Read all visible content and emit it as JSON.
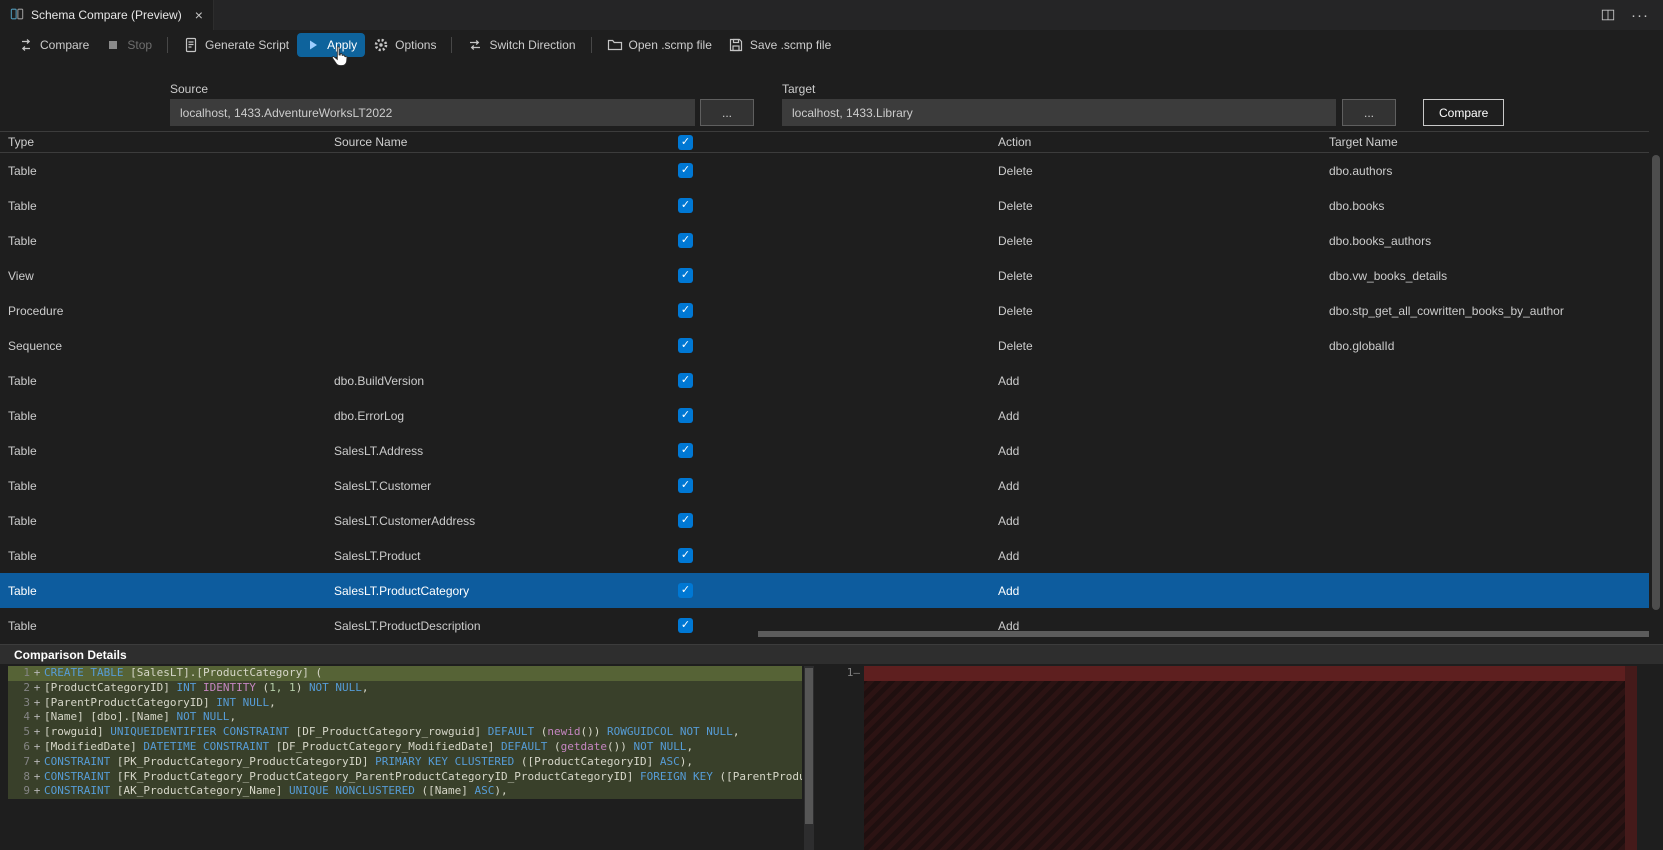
{
  "tab_bar": {
    "tab_title": "Schema Compare (Preview)",
    "close_glyph": "×",
    "more_actions_glyph": "···"
  },
  "toolbar": {
    "items": [
      {
        "label": "Compare",
        "icon": "compare-icon",
        "state": "normal",
        "sep_after": false
      },
      {
        "label": "Stop",
        "icon": "stop-icon",
        "state": "disabled",
        "sep_after": true
      },
      {
        "label": "Generate Script",
        "icon": "script-icon",
        "state": "normal",
        "sep_after": false
      },
      {
        "label": "Apply",
        "icon": "play-icon",
        "state": "active",
        "sep_after": false
      },
      {
        "label": "Options",
        "icon": "gear-icon",
        "state": "normal",
        "sep_after": true
      },
      {
        "label": "Switch Direction",
        "icon": "switch-icon",
        "state": "normal",
        "sep_after": true
      },
      {
        "label": "Open .scmp file",
        "icon": "open-file-icon",
        "state": "normal",
        "sep_after": false
      },
      {
        "label": "Save .scmp file",
        "icon": "save-file-icon",
        "state": "normal",
        "sep_after": false
      }
    ]
  },
  "connections": {
    "source_label": "Source",
    "source_value": "localhost, 1433.AdventureWorksLT2022",
    "target_label": "Target",
    "target_value": "localhost, 1433.Library",
    "browse_label": "...",
    "compare_label": "Compare"
  },
  "grid": {
    "headers": {
      "type": "Type",
      "source": "Source Name",
      "action": "Action",
      "target": "Target Name"
    },
    "check_glyph": "✓",
    "header_checkbox_checked": true,
    "rows": [
      {
        "type": "Table",
        "source": "",
        "checked": true,
        "action": "Delete",
        "target": "dbo.authors",
        "selected": false
      },
      {
        "type": "Table",
        "source": "",
        "checked": true,
        "action": "Delete",
        "target": "dbo.books",
        "selected": false
      },
      {
        "type": "Table",
        "source": "",
        "checked": true,
        "action": "Delete",
        "target": "dbo.books_authors",
        "selected": false
      },
      {
        "type": "View",
        "source": "",
        "checked": true,
        "action": "Delete",
        "target": "dbo.vw_books_details",
        "selected": false
      },
      {
        "type": "Procedure",
        "source": "",
        "checked": true,
        "action": "Delete",
        "target": "dbo.stp_get_all_cowritten_books_by_author",
        "selected": false
      },
      {
        "type": "Sequence",
        "source": "",
        "checked": true,
        "action": "Delete",
        "target": "dbo.globalId",
        "selected": false
      },
      {
        "type": "Table",
        "source": "dbo.BuildVersion",
        "checked": true,
        "action": "Add",
        "target": "",
        "selected": false
      },
      {
        "type": "Table",
        "source": "dbo.ErrorLog",
        "checked": true,
        "action": "Add",
        "target": "",
        "selected": false
      },
      {
        "type": "Table",
        "source": "SalesLT.Address",
        "checked": true,
        "action": "Add",
        "target": "",
        "selected": false
      },
      {
        "type": "Table",
        "source": "SalesLT.Customer",
        "checked": true,
        "action": "Add",
        "target": "",
        "selected": false
      },
      {
        "type": "Table",
        "source": "SalesLT.CustomerAddress",
        "checked": true,
        "action": "Add",
        "target": "",
        "selected": false
      },
      {
        "type": "Table",
        "source": "SalesLT.Product",
        "checked": true,
        "action": "Add",
        "target": "",
        "selected": false
      },
      {
        "type": "Table",
        "source": "SalesLT.ProductCategory",
        "checked": true,
        "action": "Add",
        "target": "",
        "selected": true
      },
      {
        "type": "Table",
        "source": "SalesLT.ProductDescription",
        "checked": true,
        "action": "Add",
        "target": "",
        "selected": false
      }
    ]
  },
  "details": {
    "title": "Comparison Details",
    "left": {
      "lines": [
        {
          "num": "1",
          "sign": "+",
          "emphasis": true,
          "tokens": [
            {
              "t": "CREATE TABLE",
              "c": "kw"
            },
            {
              "t": " [SalesLT].[ProductCategory] (",
              "c": "id"
            }
          ]
        },
        {
          "num": "2",
          "sign": "+",
          "emphasis": false,
          "tokens": [
            {
              "t": "[ProductCategoryID] ",
              "c": "id"
            },
            {
              "t": "INT",
              "c": "kw"
            },
            {
              "t": " ",
              "c": "id"
            },
            {
              "t": "IDENTITY",
              "c": "fn"
            },
            {
              "t": " (",
              "c": "id"
            },
            {
              "t": "1, 1",
              "c": "num"
            },
            {
              "t": ") ",
              "c": "id"
            },
            {
              "t": "NOT NULL",
              "c": "kw"
            },
            {
              "t": ",",
              "c": "id"
            }
          ]
        },
        {
          "num": "3",
          "sign": "+",
          "emphasis": false,
          "tokens": [
            {
              "t": "[ParentProductCategoryID] ",
              "c": "id"
            },
            {
              "t": "INT NULL",
              "c": "kw"
            },
            {
              "t": ",",
              "c": "id"
            }
          ]
        },
        {
          "num": "4",
          "sign": "+",
          "emphasis": false,
          "tokens": [
            {
              "t": "[Name] [dbo].[Name] ",
              "c": "id"
            },
            {
              "t": "NOT NULL",
              "c": "kw"
            },
            {
              "t": ",",
              "c": "id"
            }
          ]
        },
        {
          "num": "5",
          "sign": "+",
          "emphasis": false,
          "tokens": [
            {
              "t": "[rowguid] ",
              "c": "id"
            },
            {
              "t": "UNIQUEIDENTIFIER CONSTRAINT",
              "c": "kw"
            },
            {
              "t": " [DF_ProductCategory_rowguid] ",
              "c": "id"
            },
            {
              "t": "DEFAULT",
              "c": "kw"
            },
            {
              "t": " (",
              "c": "id"
            },
            {
              "t": "newid",
              "c": "fn"
            },
            {
              "t": "()) ",
              "c": "id"
            },
            {
              "t": "ROWGUIDCOL NOT NULL",
              "c": "kw"
            },
            {
              "t": ",",
              "c": "id"
            }
          ]
        },
        {
          "num": "6",
          "sign": "+",
          "emphasis": false,
          "tokens": [
            {
              "t": "[ModifiedDate] ",
              "c": "id"
            },
            {
              "t": "DATETIME CONSTRAINT",
              "c": "kw"
            },
            {
              "t": " [DF_ProductCategory_ModifiedDate] ",
              "c": "id"
            },
            {
              "t": "DEFAULT",
              "c": "kw"
            },
            {
              "t": " (",
              "c": "id"
            },
            {
              "t": "getdate",
              "c": "fn"
            },
            {
              "t": "()) ",
              "c": "id"
            },
            {
              "t": "NOT NULL",
              "c": "kw"
            },
            {
              "t": ",",
              "c": "id"
            }
          ]
        },
        {
          "num": "7",
          "sign": "+",
          "emphasis": false,
          "tokens": [
            {
              "t": "CONSTRAINT",
              "c": "kw"
            },
            {
              "t": " [PK_ProductCategory_ProductCategoryID] ",
              "c": "id"
            },
            {
              "t": "PRIMARY KEY CLUSTERED",
              "c": "kw"
            },
            {
              "t": " ([ProductCategoryID] ",
              "c": "id"
            },
            {
              "t": "ASC",
              "c": "kw"
            },
            {
              "t": "),",
              "c": "id"
            }
          ]
        },
        {
          "num": "8",
          "sign": "+",
          "emphasis": false,
          "tokens": [
            {
              "t": "CONSTRAINT",
              "c": "kw"
            },
            {
              "t": " [FK_ProductCategory_ProductCategory_ParentProductCategoryID_ProductCategoryID] ",
              "c": "id"
            },
            {
              "t": "FOREIGN KEY",
              "c": "kw"
            },
            {
              "t": " ([ParentProductCatego",
              "c": "id"
            }
          ]
        },
        {
          "num": "9",
          "sign": "+",
          "emphasis": false,
          "tokens": [
            {
              "t": "CONSTRAINT",
              "c": "kw"
            },
            {
              "t": " [AK_ProductCategory_Name] ",
              "c": "id"
            },
            {
              "t": "UNIQUE NONCLUSTERED",
              "c": "kw"
            },
            {
              "t": " ([Name] ",
              "c": "id"
            },
            {
              "t": "ASC",
              "c": "kw"
            },
            {
              "t": "),",
              "c": "id"
            }
          ]
        }
      ]
    },
    "right": {
      "num": "1",
      "mark": "–"
    }
  },
  "colors": {
    "accent_blue": "#0e639c",
    "checkbox_blue": "#0078d4",
    "selected_row_blue": "#0d5c9e",
    "added_line_bg": "#373d29",
    "deleted_region_bg": "#2c1313",
    "keyword": "#569cd6",
    "function": "#c586c0",
    "number": "#b5cea8"
  }
}
